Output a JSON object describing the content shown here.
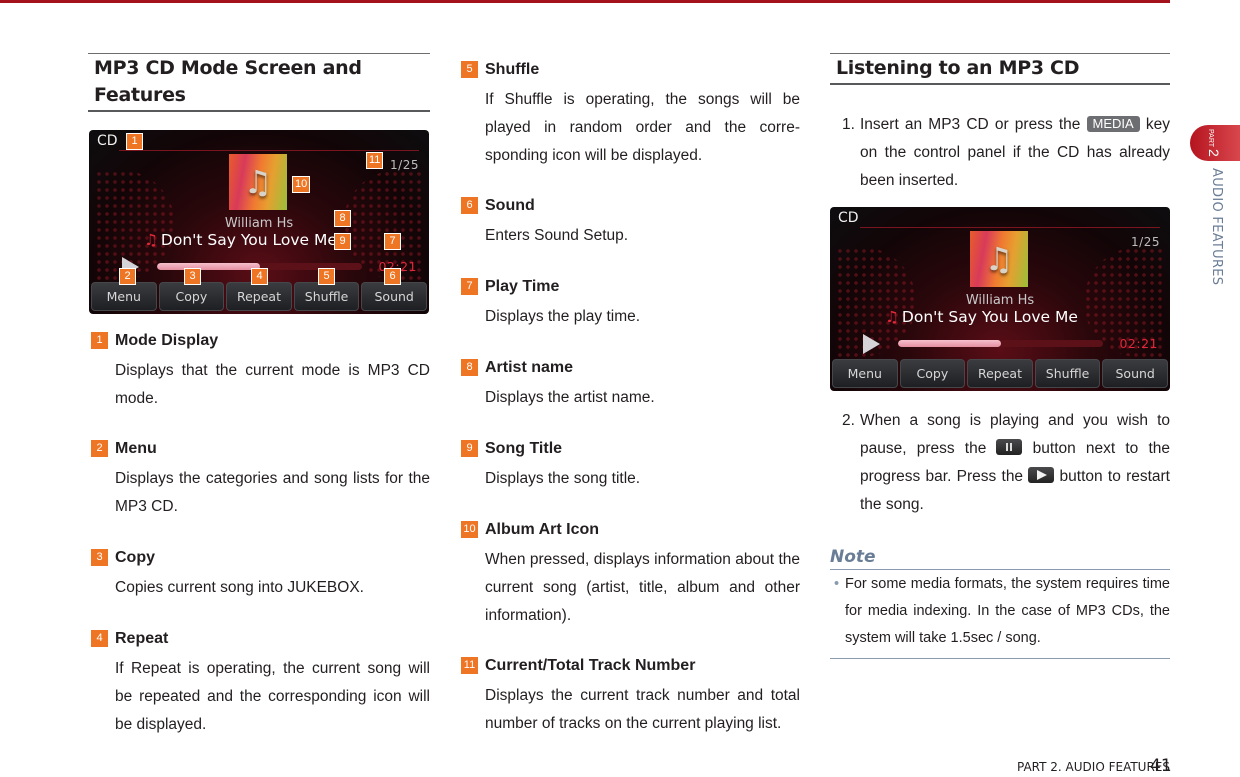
{
  "colors": {
    "accent_red": "#a3121d",
    "callout_orange": "#ee7523",
    "note_blue": "#6a7d96",
    "time_red": "#e0283a"
  },
  "left": {
    "heading": "MP3 CD Mode Screen and Features",
    "screen": {
      "mode": "CD",
      "track": "1/25",
      "artist": "William Hs",
      "title": "Don't Say You Love Me",
      "time": "02:21",
      "progress_fraction": 0.5,
      "buttons": [
        "Menu",
        "Copy",
        "Repeat",
        "Shuffle",
        "Sound"
      ],
      "icons": {
        "album": "music-note-icon",
        "play": "play-icon"
      },
      "callouts": [
        "1",
        "2",
        "3",
        "4",
        "5",
        "6",
        "7",
        "8",
        "9",
        "10",
        "11"
      ]
    },
    "items": [
      {
        "num": "1",
        "name": "Mode Display",
        "desc": "Displays that the current mode is MP3 CD mode."
      },
      {
        "num": "2",
        "name": "Menu",
        "desc": "Displays the categories and song lists for the MP3 CD."
      },
      {
        "num": "3",
        "name": "Copy",
        "desc": "Copies current song into JUKEBOX."
      },
      {
        "num": "4",
        "name": "Repeat",
        "desc": "If Repeat is operating, the current song will be repeated and the corresponding icon will be displayed."
      }
    ]
  },
  "middle": {
    "items": [
      {
        "num": "5",
        "name": "Shuffle",
        "desc": "If Shuffle is operating, the songs will be played in random order and the corre-sponding icon will be displayed."
      },
      {
        "num": "6",
        "name": "Sound",
        "desc": "Enters Sound Setup."
      },
      {
        "num": "7",
        "name": "Play Time",
        "desc": "Displays the play time."
      },
      {
        "num": "8",
        "name": "Artist name",
        "desc": "Displays the artist name."
      },
      {
        "num": "9",
        "name": "Song Title",
        "desc": "Displays the song title."
      },
      {
        "num": "10",
        "name": "Album Art Icon",
        "desc": "When pressed, displays information about the current song (artist, title, album and other information)."
      },
      {
        "num": "11",
        "name": "Current/Total Track Number",
        "desc": "Displays the current track number and total number of tracks on the current playing list."
      }
    ]
  },
  "right": {
    "heading": "Listening to an MP3 CD",
    "step1": {
      "num": "1.",
      "before": "Insert an MP3 CD or press the ",
      "key": "MEDIA",
      "after": " key on the control panel if the CD has already been inserted."
    },
    "screen": {
      "mode": "CD",
      "track": "1/25",
      "artist": "William Hs",
      "title": "Don't Say You Love Me",
      "time": "02:21",
      "progress_fraction": 0.5,
      "buttons": [
        "Menu",
        "Copy",
        "Repeat",
        "Shuffle",
        "Sound"
      ]
    },
    "step2": {
      "num": "2.",
      "part1": "When a song is playing and you wish to pause, press the ",
      "part2": " button next to the progress bar. Press the ",
      "part3": " button to restart the song."
    },
    "note": {
      "heading": "Note",
      "text": "For some media formats, the system requires time for media indexing. In the case of MP3 CDs, the system will take 1.5sec / song."
    }
  },
  "side": {
    "part_small": "PART",
    "part_num": "2",
    "section": "AUDIO FEATURES"
  },
  "footer": {
    "label": "PART 2. AUDIO FEATURES",
    "page": "41"
  }
}
